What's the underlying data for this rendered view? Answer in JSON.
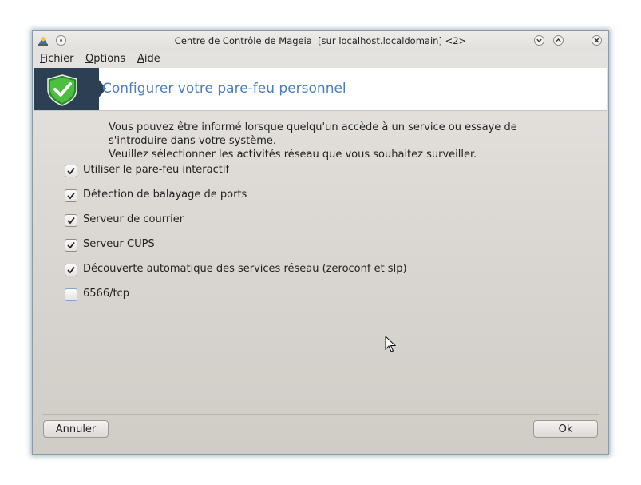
{
  "window": {
    "title": "Centre de Contrôle de Mageia  [sur localhost.localdomain] <2>"
  },
  "menu": {
    "items": [
      {
        "mnemonic": "F",
        "rest": "ichier"
      },
      {
        "mnemonic": "O",
        "rest": "ptions"
      },
      {
        "mnemonic": "A",
        "rest": "ide"
      }
    ]
  },
  "banner": {
    "title": "Configurer votre pare-feu personnel",
    "icon": "shield-check-icon"
  },
  "intro": {
    "line1": "Vous pouvez être informé lorsque quelqu'un accède à un service ou essaye de",
    "line2": "s'introduire dans votre système.",
    "line3": "Veuillez sélectionner les activités réseau que vous souhaitez surveiller."
  },
  "options": [
    {
      "label": "Utiliser le pare-feu interactif",
      "checked": true
    },
    {
      "label": "Détection de balayage de ports",
      "checked": true
    },
    {
      "label": "Serveur de courrier",
      "checked": true
    },
    {
      "label": "Serveur CUPS",
      "checked": true
    },
    {
      "label": "Découverte automatique des services réseau (zeroconf et slp)",
      "checked": true
    },
    {
      "label": "6566/tcp",
      "checked": false
    }
  ],
  "buttons": {
    "cancel": "Annuler",
    "ok": "Ok"
  },
  "colors": {
    "accent": "#4a7fc0",
    "banner_logo_bg": "#2d3f52",
    "shield": "#3aa83a"
  }
}
